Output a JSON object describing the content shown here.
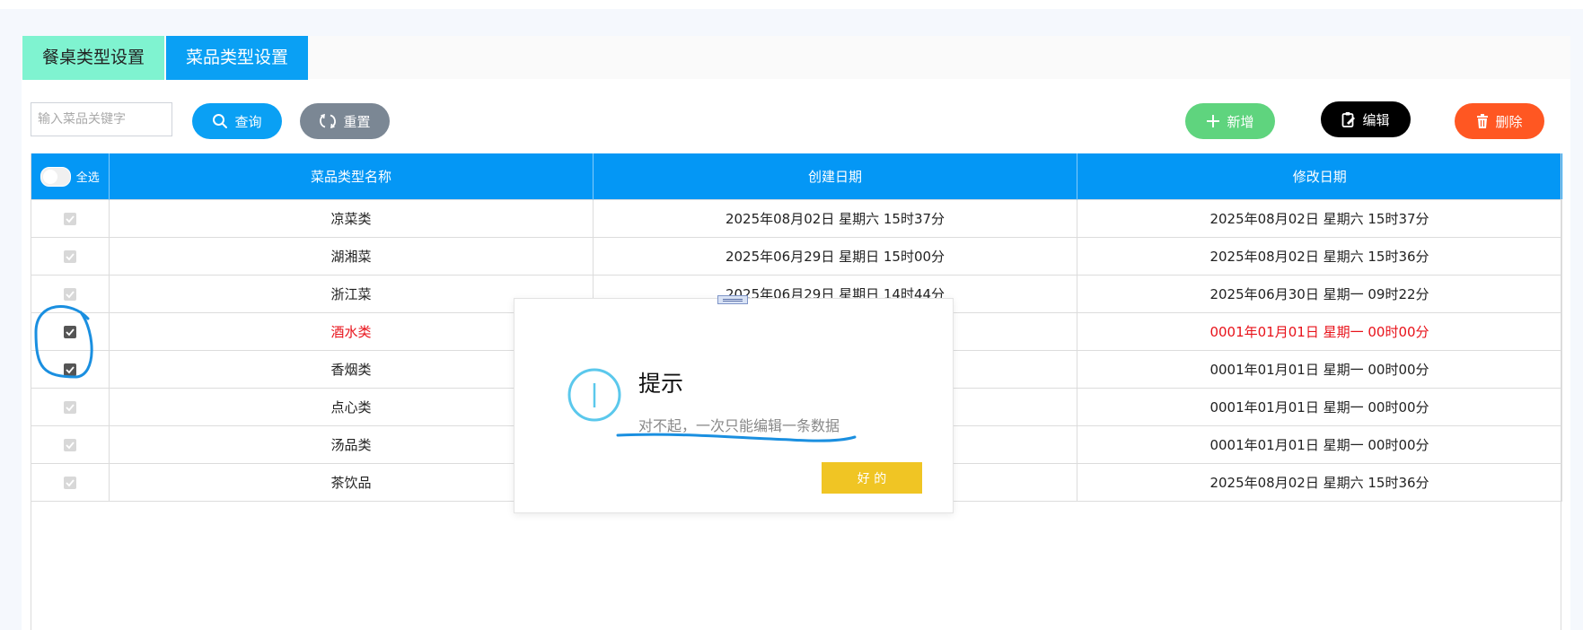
{
  "tabs": [
    {
      "label": "餐桌类型设置",
      "active": false
    },
    {
      "label": "菜品类型设置",
      "active": true
    }
  ],
  "toolbar": {
    "search_placeholder": "输入菜品关键字",
    "search_value": "",
    "query_label": "查询",
    "reset_label": "重置",
    "add_label": "新增",
    "edit_label": "编辑",
    "delete_label": "删除"
  },
  "table": {
    "select_all_label": "全选",
    "headers": [
      "菜品类型名称",
      "创建日期",
      "修改日期"
    ],
    "rows": [
      {
        "checked": false,
        "name": "凉菜类",
        "created": "2025年08月02日  星期六  15时37分",
        "modified": "2025年08月02日  星期六  15时37分",
        "highlight": false
      },
      {
        "checked": false,
        "name": "湖湘菜",
        "created": "2025年06月29日  星期日  15时00分",
        "modified": "2025年08月02日  星期六  15时36分",
        "highlight": false
      },
      {
        "checked": false,
        "name": "浙江菜",
        "created": "2025年06月29日  星期日  14时44分",
        "modified": "2025年06月30日  星期一  09时22分",
        "highlight": false
      },
      {
        "checked": true,
        "name": "酒水类",
        "created": "",
        "modified": "0001年01月01日  星期一  00时00分",
        "highlight": true
      },
      {
        "checked": true,
        "name": "香烟类",
        "created": "",
        "modified": "0001年01月01日  星期一  00时00分",
        "highlight": false
      },
      {
        "checked": false,
        "name": "点心类",
        "created": "",
        "modified": "0001年01月01日  星期一  00时00分",
        "highlight": false
      },
      {
        "checked": false,
        "name": "汤品类",
        "created": "",
        "modified": "0001年01月01日  星期一  00时00分",
        "highlight": false
      },
      {
        "checked": false,
        "name": "茶饮品",
        "created": "",
        "modified": "2025年08月02日  星期六  15时36分",
        "highlight": false
      }
    ]
  },
  "dialog": {
    "title": "提示",
    "message": "对不起，一次只能编辑一条数据",
    "ok_label": "好 的",
    "icon": "info-icon"
  },
  "colors": {
    "primary": "#0497f5",
    "tab_inactive": "#7ff3d0",
    "add": "#5fd47e",
    "edit": "#000000",
    "delete": "#ff5722",
    "reset": "#7b8794",
    "ok": "#f0c524",
    "highlight_text": "#e8121a",
    "annotation": "#1a8fe0"
  }
}
